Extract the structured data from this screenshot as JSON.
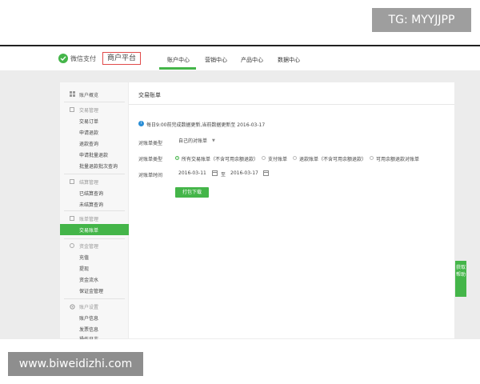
{
  "watermark_top": "TG: MYYJJPP",
  "watermark_bottom": "www.biweidizhi.com",
  "header": {
    "logo_text": "微信支付",
    "platform_label": "商户平台",
    "nav": [
      {
        "label": "账户中心",
        "active": true
      },
      {
        "label": "营销中心",
        "active": false
      },
      {
        "label": "产品中心",
        "active": false
      },
      {
        "label": "数据中心",
        "active": false
      }
    ]
  },
  "sidebar": {
    "overview": "账户概览",
    "groups": [
      {
        "title": "交易管理",
        "items": [
          "交易订单",
          "申请退款",
          "退款查询",
          "申请批量退款",
          "批量退款批次查询"
        ]
      },
      {
        "title": "结算管理",
        "items": [
          "已结算查询",
          "未结算查询"
        ]
      },
      {
        "title": "账单管理",
        "items": [
          "交易账单"
        ]
      },
      {
        "title": "资金管理",
        "items": [
          "充值",
          "提现",
          "资金流水",
          "保证金管理"
        ]
      },
      {
        "title": "账户设置",
        "items": [
          "账户信息",
          "发票信息",
          "操作日志"
        ]
      }
    ],
    "active_item": "交易账单"
  },
  "main": {
    "title": "交易账单",
    "notice": "每日9:00前完成数据更新,当前数据更新至 2016-03-17",
    "form": {
      "bill_type_label": "对账单类型",
      "bill_type_value": "自己的对账单",
      "trade_type_label": "对账单类型",
      "trade_type_options": [
        {
          "label": "所有交易账单（不含可用余额退款）",
          "selected": true
        },
        {
          "label": "支付账单",
          "selected": false
        },
        {
          "label": "退款账单（不含可用余额退款）",
          "selected": false
        },
        {
          "label": "可用余额退款对账单",
          "selected": false
        }
      ],
      "date_label": "对账单时间",
      "date_from": "2016-03-11",
      "date_sep": "至",
      "date_to": "2016-03-17",
      "download_button": "打包下载"
    }
  },
  "float_tab": "获取帮助",
  "colors": {
    "accent": "#44b549",
    "info": "#2a8ed6",
    "highlight_box": "#e04a4a"
  }
}
